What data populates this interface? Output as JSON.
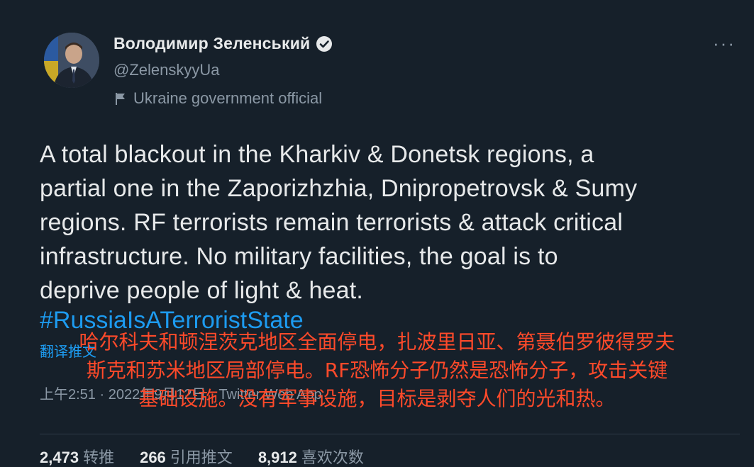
{
  "author": {
    "display_name": "Володимир Зеленський",
    "handle": "@ZelenskyyUa",
    "label": "Ukraine government official"
  },
  "tweet": {
    "lines": [
      "A total blackout in the Kharkiv & Donetsk regions, a",
      "partial one in the Zaporizhzhia, Dnipropetrovsk & Sumy",
      "regions. RF terrorists remain terrorists & attack critical",
      "infrastructure. No military facilities, the goal is to",
      "deprive people of light & heat."
    ],
    "hashtag": "#RussiaIsATerroristState",
    "translate_label": "翻译推文",
    "meta": "上午2:51 · 2022年9月12日 · Twitter Web App"
  },
  "overlay_translation": {
    "line1": "哈尔科夫和顿涅茨克地区全面停电，扎波里日亚、第聂伯罗彼得罗夫",
    "line2": "斯克和苏米地区局部停电。RF恐怖分子仍然是恐怖分子，攻击关键",
    "line3": "基础设施。没有军事设施，目标是剥夺人们的光和热。"
  },
  "stats": {
    "retweets": {
      "count": "2,473",
      "label": "转推"
    },
    "quotes": {
      "count": "266",
      "label": "引用推文"
    },
    "likes": {
      "count": "8,912",
      "label": "喜欢次数"
    }
  },
  "colors": {
    "background": "#16202a",
    "text": "#e7e9ea",
    "secondary": "#8b98a5",
    "link": "#1d9bf0",
    "overlay": "#ff4a2a"
  },
  "icons": {
    "verified": "verified-badge-icon",
    "label": "flag-icon",
    "more": "more-options-icon"
  }
}
